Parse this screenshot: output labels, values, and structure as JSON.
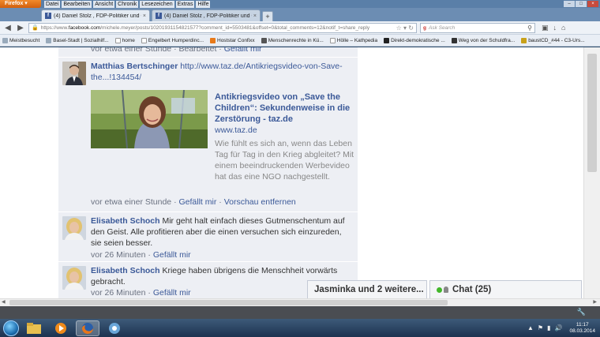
{
  "browser": {
    "app_button": "Firefox",
    "menu": [
      "Datei",
      "Bearbeiten",
      "Ansicht",
      "Chronik",
      "Lesezeichen",
      "Extras",
      "Hilfe"
    ],
    "tabs": [
      {
        "label": "(4) Daniel Stolz , FDP-Politiker und Ge..."
      },
      {
        "label": "(4) Daniel Stolz , FDP-Politiker und Ge..."
      }
    ],
    "new_tab": "+",
    "url_scheme": "https://www.",
    "url_domain": "facebook.com",
    "url_path": "/michele.meyer/posts/10201931154821577?comment_id=5503481&offset=0&total_comments=12&notif_t=share_reply",
    "search_placeholder": "Ask Search",
    "search_engine_letter": "g",
    "bookmarks": [
      "Meistbesucht",
      "Basel-Stadt | Sozialhilf...",
      "home",
      "Engelbert Humperdinc...",
      "Hoststar Confixx",
      "Menschenrechte in Kü...",
      "Hölle – Kathpedia",
      "Direkt-demokratische ...",
      "Weg von der Schuldfra...",
      "baustCD_#44 - C3-Urs..."
    ]
  },
  "feed": {
    "top_meta": {
      "time": "vor etwa einer Stunde",
      "edited": "Bearbeitet",
      "like": "Gefällt mir",
      "sep": " · "
    },
    "comments": [
      {
        "author": "Matthias Bertschinger",
        "text": "http://www.taz.de/Antikriegsvideo-von-Save-the...!134454/",
        "share": {
          "title": "Antikriegsvideo von „Save the Children“: Sekundenweise in die Zerstörung - taz.de",
          "domain": "www.taz.de",
          "description": "Wie fühlt es sich an, wenn das Leben Tag für Tag in den Krieg abgleitet? Mit einem beeindruckenden Werbevideo hat das eine NGO nachgestellt."
        },
        "time": "vor etwa einer Stunde",
        "like": "Gefällt mir",
        "remove_preview": "Vorschau entfernen"
      },
      {
        "author": "Elisabeth Schoch",
        "text": "Mir geht halt einfach dieses Gutmenschentum auf den Geist. Alle profitieren aber die einen versuchen sich einzureden, sie seien besser.",
        "time": "vor 26 Minuten",
        "like": "Gefällt mir"
      },
      {
        "author": "Elisabeth Schoch",
        "text": "Kriege haben übrigens die Menschheit vorwärts gebracht.",
        "time": "vor 26 Minuten",
        "like": "Gefällt mir"
      }
    ]
  },
  "chat": {
    "conversation_label": "Jasminka und 2 weitere...",
    "chat_label": "Chat (25)",
    "online_color": "#42b72a"
  },
  "taskbar": {
    "time": "11:17",
    "date": "08.03.2014"
  },
  "colors": {
    "facebook_blue": "#3b5998",
    "feed_bg": "#edeff4",
    "firefox_orange": "#e8761a"
  }
}
